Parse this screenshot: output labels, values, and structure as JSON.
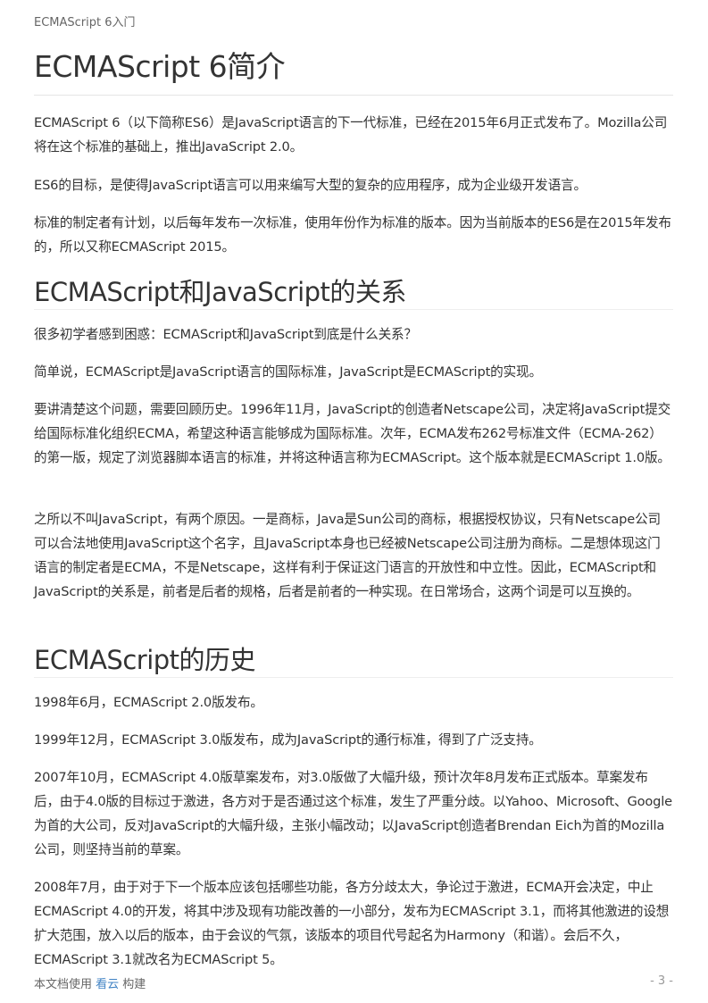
{
  "header": {
    "running_title": "ECMAScript 6入门"
  },
  "sections": [
    {
      "title": "ECMAScript 6简介",
      "paragraphs": [
        "ECMAScript 6（以下简称ES6）是JavaScript语言的下一代标准，已经在2015年6月正式发布了。Mozilla公司将在这个标准的基础上，推出JavaScript 2.0。",
        "ES6的目标，是使得JavaScript语言可以用来编写大型的复杂的应用程序，成为企业级开发语言。",
        "标准的制定者有计划，以后每年发布一次标准，使用年份作为标准的版本。因为当前版本的ES6是在2015年发布的，所以又称ECMAScript 2015。"
      ]
    },
    {
      "title": "ECMAScript和JavaScript的关系",
      "paragraphs": [
        "很多初学者感到困惑：ECMAScript和JavaScript到底是什么关系？",
        "简单说，ECMAScript是JavaScript语言的国际标准，JavaScript是ECMAScript的实现。",
        "要讲清楚这个问题，需要回顾历史。1996年11月，JavaScript的创造者Netscape公司，决定将JavaScript提交给国际标准化组织ECMA，希望这种语言能够成为国际标准。次年，ECMA发布262号标准文件（ECMA-262）的第一版，规定了浏览器脚本语言的标准，并将这种语言称为ECMAScript。这个版本就是ECMAScript 1.0版。",
        "之所以不叫JavaScript，有两个原因。一是商标，Java是Sun公司的商标，根据授权协议，只有Netscape公司可以合法地使用JavaScript这个名字，且JavaScript本身也已经被Netscape公司注册为商标。二是想体现这门语言的制定者是ECMA，不是Netscape，这样有利于保证这门语言的开放性和中立性。因此，ECMAScript和JavaScript的关系是，前者是后者的规格，后者是前者的一种实现。在日常场合，这两个词是可以互换的。"
      ]
    },
    {
      "title": "ECMAScript的历史",
      "paragraphs": [
        "1998年6月，ECMAScript 2.0版发布。",
        "1999年12月，ECMAScript 3.0版发布，成为JavaScript的通行标准，得到了广泛支持。",
        "2007年10月，ECMAScript 4.0版草案发布，对3.0版做了大幅升级，预计次年8月发布正式版本。草案发布后，由于4.0版的目标过于激进，各方对于是否通过这个标准，发生了严重分歧。以Yahoo、Microsoft、Google为首的大公司，反对JavaScript的大幅升级，主张小幅改动；以JavaScript创造者Brendan Eich为首的Mozilla公司，则坚持当前的草案。",
        "2008年7月，由于对于下一个版本应该包括哪些功能，各方分歧太大，争论过于激进，ECMA开会决定，中止ECMAScript 4.0的开发，将其中涉及现有功能改善的一小部分，发布为ECMAScript 3.1，而将其他激进的设想扩大范围，放入以后的版本，由于会议的气氛，该版本的项目代号起名为Harmony（和谐）。会后不久，ECMAScript 3.1就改名为ECMAScript 5。"
      ]
    }
  ],
  "footer": {
    "prefix": "本文档使用 ",
    "link": "看云",
    "suffix": " 构建",
    "page_number": "- 3 -"
  }
}
